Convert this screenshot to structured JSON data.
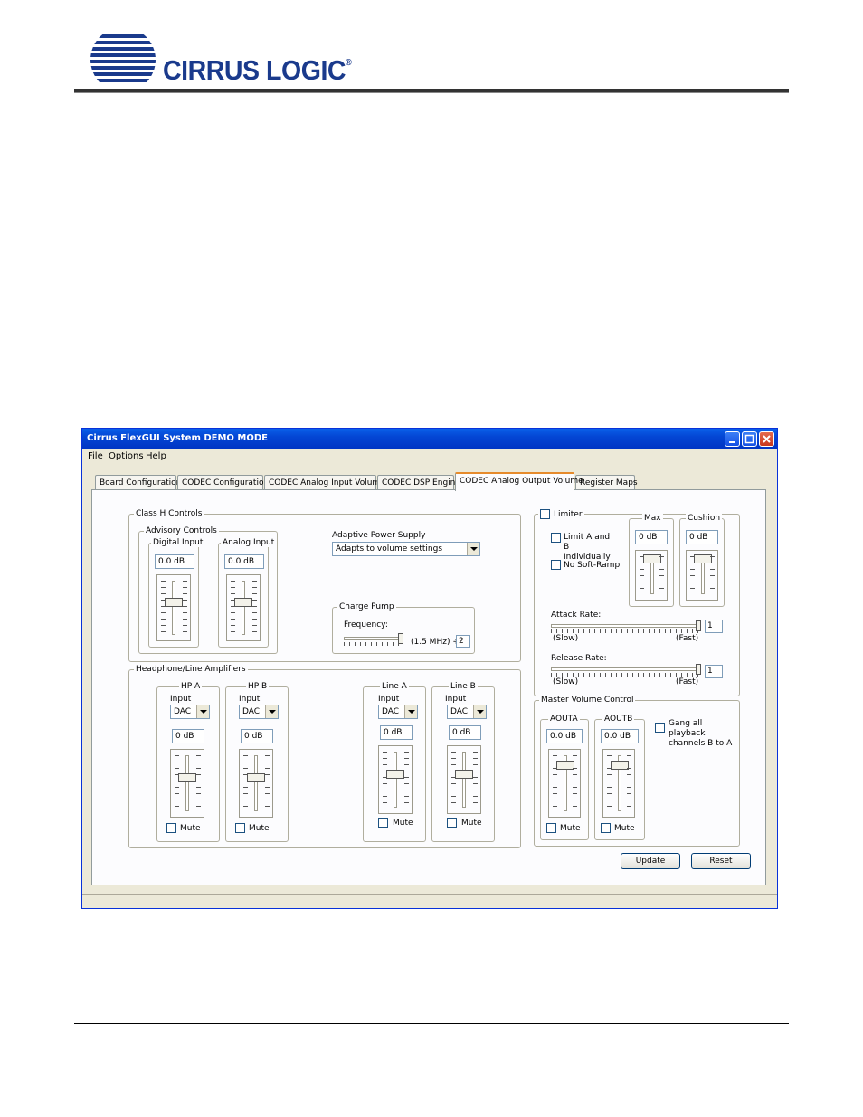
{
  "document": {
    "logo_text": "CIRRUS LOGIC",
    "logo_mark": "®"
  },
  "window": {
    "title": "Cirrus FlexGUI System DEMO MODE",
    "menu": [
      "File",
      "Options",
      "Help"
    ],
    "tabs": [
      "Board Configuration",
      "CODEC Configuration",
      "CODEC Analog Input Volume",
      "CODEC DSP Engine",
      "CODEC Analog Output Volume",
      "Register Maps"
    ],
    "active_tab": "CODEC Analog Output Volume"
  },
  "class_h": {
    "group_label": "Class H Controls",
    "advisory": {
      "label": "Advisory Controls",
      "digital_input": {
        "label": "Digital Input",
        "value": "0.0 dB",
        "level": 0.4
      },
      "analog_input": {
        "label": "Analog Input",
        "value": "0.0 dB",
        "level": 0.4
      }
    },
    "adaptive_power": {
      "label": "Adaptive Power Supply",
      "value": "Adapts to volume settings"
    },
    "charge_pump": {
      "label": "Charge Pump",
      "frequency_label": "Frequency:",
      "frequency_value": "(1.5 MHz) ÷",
      "divider": "2",
      "level": 1.0
    }
  },
  "amplifiers": {
    "group_label": "Headphone/Line Amplifiers",
    "channels": [
      {
        "name": "HP A",
        "input_label": "Input",
        "input": "DAC",
        "value": "0 dB",
        "mute": "Mute",
        "level": 0.4
      },
      {
        "name": "HP B",
        "input_label": "Input",
        "input": "DAC",
        "value": "0 dB",
        "mute": "Mute",
        "level": 0.4
      },
      {
        "name": "Line A",
        "input_label": "Input",
        "input": "DAC",
        "value": "0 dB",
        "mute": "Mute",
        "level": 0.4
      },
      {
        "name": "Line B",
        "input_label": "Input",
        "input": "DAC",
        "value": "0 dB",
        "mute": "Mute",
        "level": 0.4
      }
    ]
  },
  "limiter": {
    "label": "Limiter",
    "limit_ab": "Limit A and B Individually",
    "no_soft_ramp": "No Soft-Ramp",
    "max": {
      "label": "Max",
      "value": "0 dB",
      "level": 0.0
    },
    "cushion": {
      "label": "Cushion",
      "value": "0 dB",
      "level": 0.0
    },
    "attack": {
      "label": "Attack Rate:",
      "slow": "(Slow)",
      "fast": "(Fast)",
      "value": "1",
      "level": 1.0
    },
    "release": {
      "label": "Release Rate:",
      "slow": "(Slow)",
      "fast": "(Fast)",
      "value": "1",
      "level": 1.0
    }
  },
  "master": {
    "group_label": "Master Volume Control",
    "aouta": {
      "label": "AOUTA",
      "value": "0.0 dB",
      "mute": "Mute",
      "level": 0.15
    },
    "aoutb": {
      "label": "AOUTB",
      "value": "0.0 dB",
      "mute": "Mute",
      "level": 0.15
    },
    "gang": "Gang all playback channels B to A"
  },
  "buttons": {
    "update": "Update",
    "reset": "Reset"
  }
}
